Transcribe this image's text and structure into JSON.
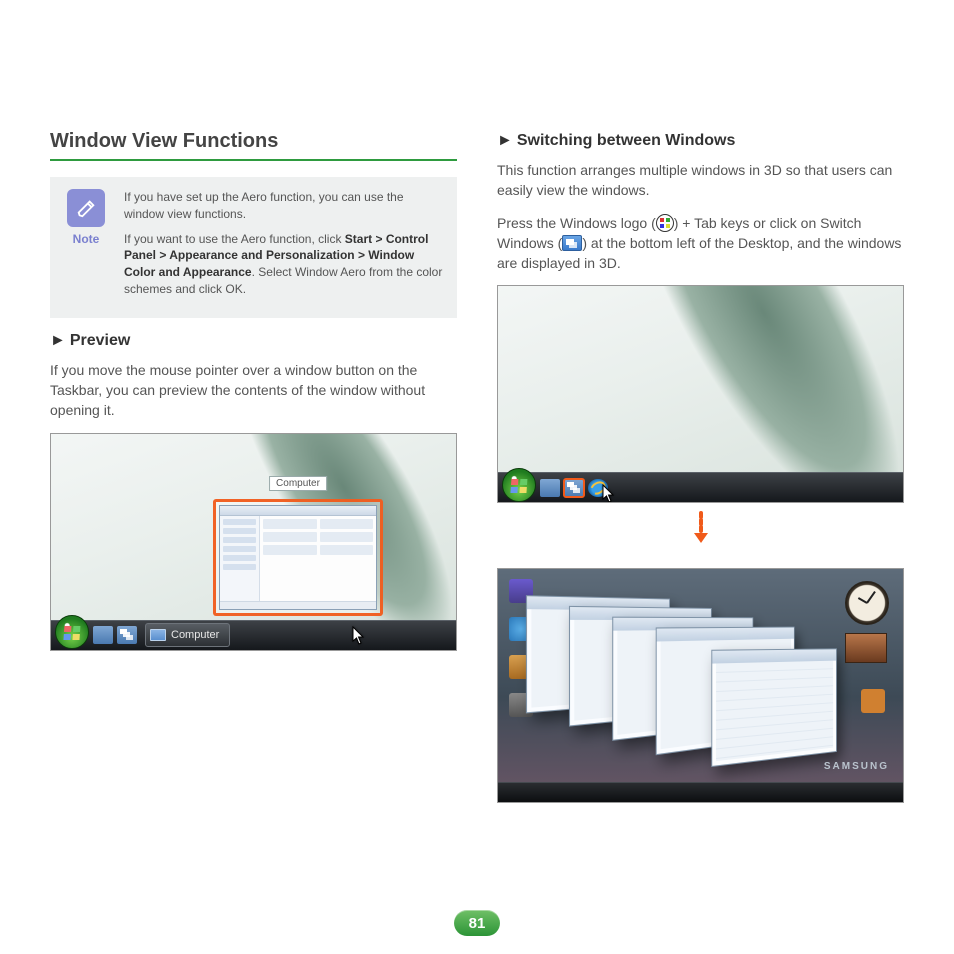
{
  "left": {
    "title": "Window View Functions",
    "note": {
      "label": "Note",
      "p1": "If you have set up the Aero function, you can use the window view functions.",
      "p2a": "If you want to use the Aero function, click ",
      "p2b": "Start > Control Panel > Appearance and Personalization > Window Color and Appearance",
      "p2c": ". Select Window Aero from the color schemes and click OK."
    },
    "preview": {
      "heading": "Preview",
      "body": "If you move the mouse pointer over a window button on the Taskbar, you can preview the contents of the window without opening it.",
      "thumb_label": "Computer",
      "task_label": "Computer"
    }
  },
  "right": {
    "heading": "Switching between Windows",
    "p1": "This function arranges multiple windows in 3D so that users can easily view the windows.",
    "p2a": "Press the Windows logo (",
    "p2b": ") + Tab keys or click on Switch Windows (",
    "p2c": ") at the bottom left of the Desktop, and the windows are displayed in 3D.",
    "brand": "SAMSUNG"
  },
  "page_number": "81",
  "arrow": "►"
}
